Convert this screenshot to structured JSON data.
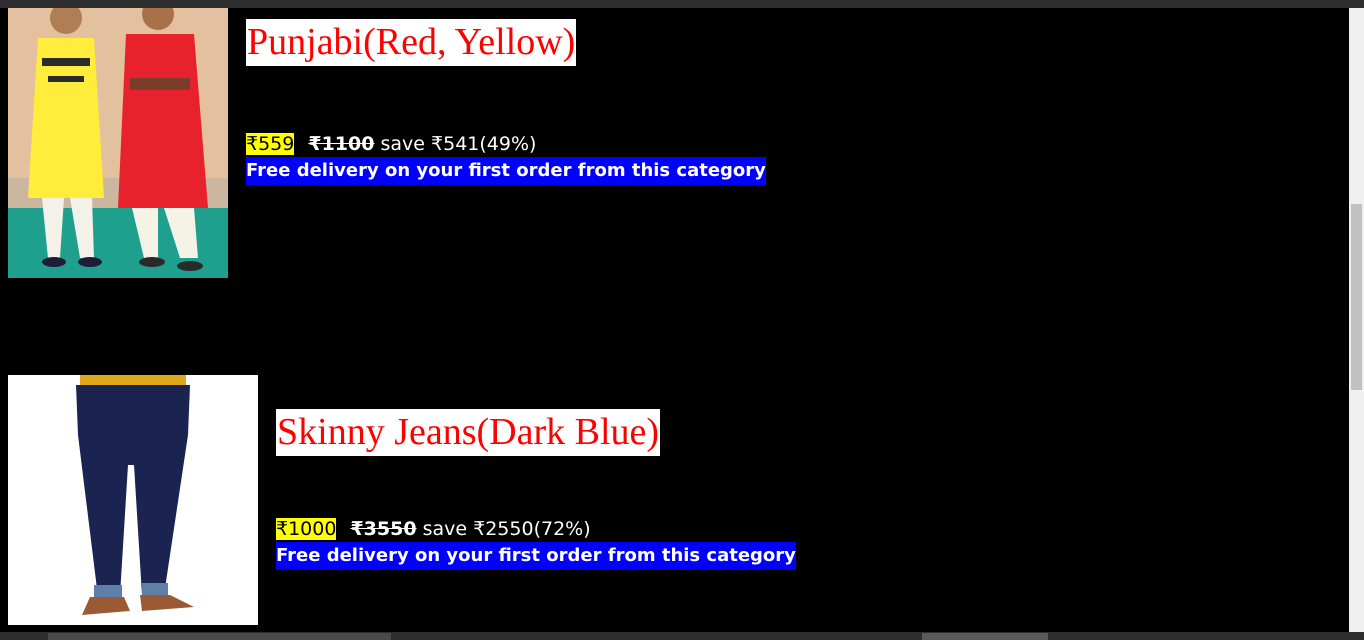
{
  "products": [
    {
      "title": "Punjabi(Red, Yellow)",
      "price": "₹559",
      "original_price": "₹1100",
      "savings": "save ₹541(49%)",
      "delivery": "Free delivery on your first order from this category"
    },
    {
      "title": "Skinny Jeans(Dark Blue)",
      "price": "₹1000",
      "original_price": "₹3550",
      "savings": "save ₹2550(72%)",
      "delivery": "Free delivery on your first order from this category"
    }
  ],
  "colors": {
    "background": "#000000",
    "title_text": "#ff0000",
    "price_highlight": "#ffff00",
    "delivery_background": "#0000ff"
  }
}
